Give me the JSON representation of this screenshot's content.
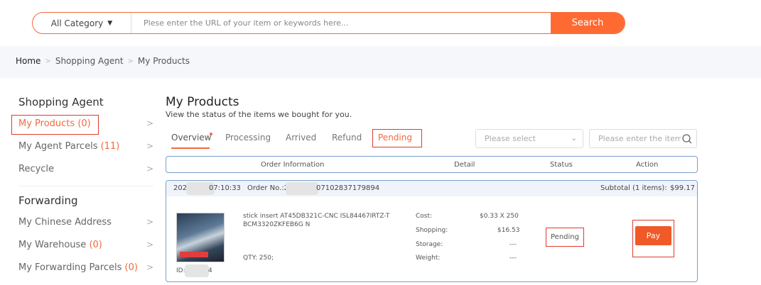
{
  "search": {
    "category": "All Category",
    "placeholder": "Plese enter the URL of your item or keywords here...",
    "button": "Search"
  },
  "breadcrumb": [
    "Home",
    "Shopping Agent",
    "My Products"
  ],
  "sidebar": {
    "shopping_agent": {
      "heading": "Shopping Agent",
      "items": [
        {
          "label": "My Products",
          "count": "(0)"
        },
        {
          "label": "My Agent Parcels",
          "count": "(11)"
        },
        {
          "label": "Recycle",
          "count": ""
        }
      ]
    },
    "forwarding": {
      "heading": "Forwarding",
      "items": [
        {
          "label": "My Chinese Address",
          "count": ""
        },
        {
          "label": "My Warehouse",
          "count": "(0)"
        },
        {
          "label": "My Forwarding Parcels",
          "count": "(0)"
        }
      ]
    }
  },
  "main": {
    "title": "My Products",
    "subtitle": "View the status of the items we bought for you.",
    "tabs": [
      "Overview",
      "Processing",
      "Arrived",
      "Refund",
      "Pending"
    ],
    "select_placeholder": "Please select",
    "id_placeholder": "Please enter the item ID"
  },
  "table": {
    "headers": [
      "Order Information",
      "Detail",
      "Status",
      "Action"
    ]
  },
  "order": {
    "date_prefix": "202",
    "date_suffix": "07:10:33",
    "order_no_label": "Order No.:2",
    "order_no_suffix": "07102837179894",
    "subtotal_label": "Subtotal (1 items):",
    "subtotal": "$99.17",
    "item_title_1": "stick insert AT45DB321C-CNC ISL84467IRTZ-T",
    "item_title_2": "BCM3320ZKFEB6G N",
    "qty": "QTY: 250;",
    "id_prefix": "ID:",
    "id_suffix": "4",
    "details": [
      {
        "label": "Cost:",
        "value": "$0.33 X 250"
      },
      {
        "label": "Shopping:",
        "value": "$16.53"
      },
      {
        "label": "Storage:",
        "value": "---"
      },
      {
        "label": "Weight:",
        "value": "---"
      }
    ],
    "status": "Pending",
    "action": "Pay"
  },
  "colors": {
    "accent": "#ff6a33",
    "highlight_box": "#e03a2e",
    "table_border": "#7a9fd0"
  }
}
